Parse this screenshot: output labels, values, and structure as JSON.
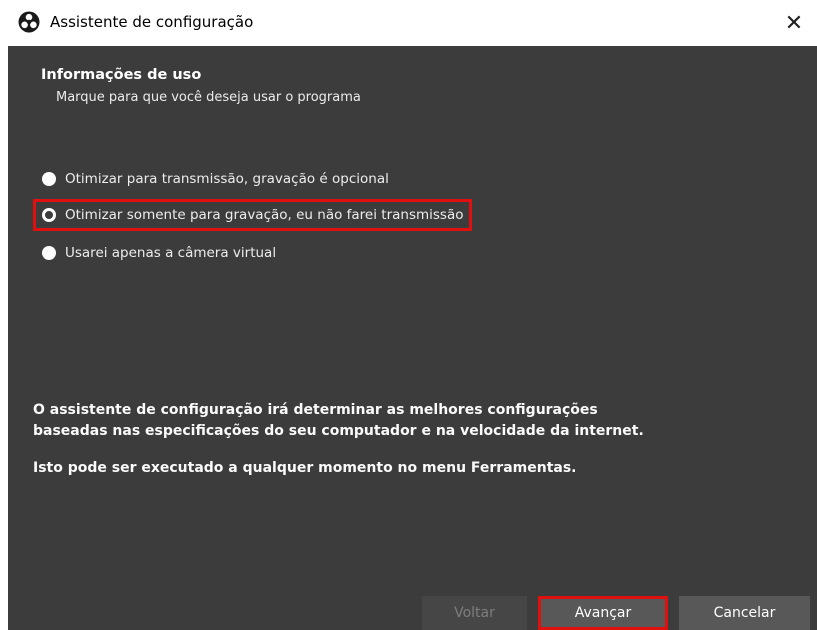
{
  "window": {
    "title": "Assistente de configuração",
    "close_glyph": "✕",
    "app_icon": "obs-logo-icon"
  },
  "section": {
    "title": "Informações de uso",
    "subtitle": "Marque para que você deseja usar o programa"
  },
  "options": [
    {
      "label": "Otimizar para transmissão, gravação é opcional",
      "checked": false
    },
    {
      "label": "Otimizar somente para gravação, eu não farei transmissão",
      "checked": true,
      "highlighted": true
    },
    {
      "label": "Usarei apenas a câmera virtual",
      "checked": false
    }
  ],
  "info": {
    "line1": "O assistente de configuração irá determinar as melhores configurações",
    "line2": "baseadas nas especificações do seu computador e na velocidade da internet.",
    "line3": "Isto pode ser executado a qualquer momento no menu Ferramentas."
  },
  "buttons": {
    "back": "Voltar",
    "next": "Avançar",
    "cancel": "Cancelar"
  },
  "colors": {
    "background": "#3c3c3c",
    "highlight": "#e01010"
  }
}
